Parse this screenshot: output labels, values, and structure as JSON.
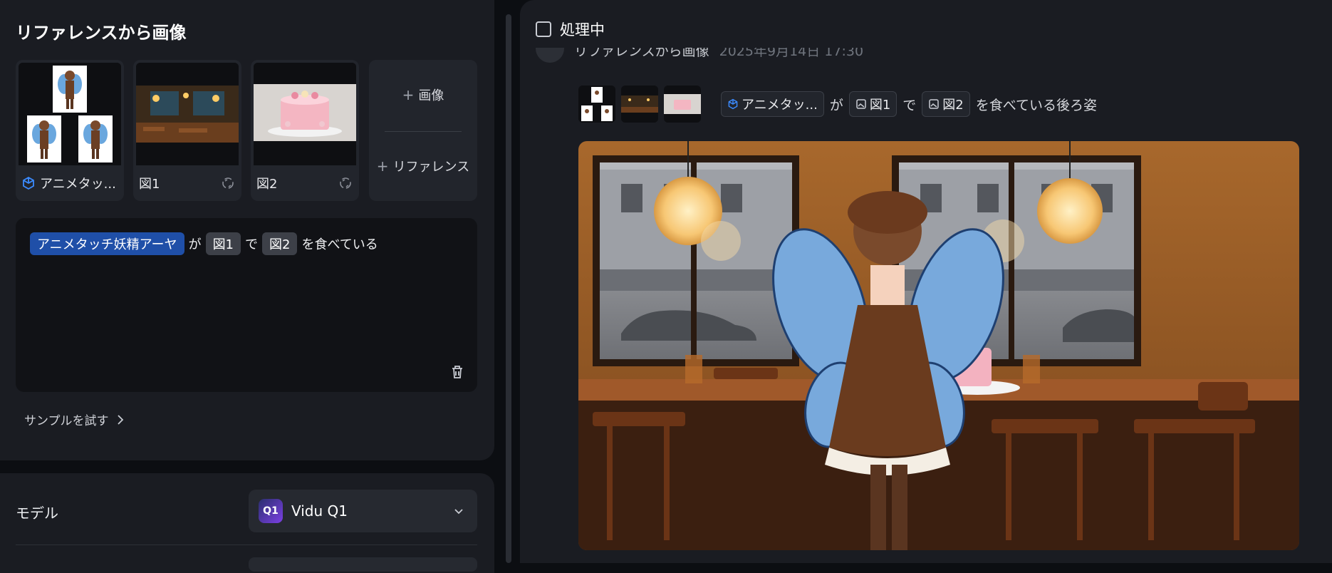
{
  "left_panel": {
    "title": "リファレンスから画像",
    "references": [
      {
        "label": "アニメタッ...",
        "icon": "cube-icon"
      },
      {
        "label": "図1",
        "icon": "swap-icon"
      },
      {
        "label": "図2",
        "icon": "swap-icon"
      }
    ],
    "add_image_label": "画像",
    "add_reference_label": "リファレンス",
    "prompt": {
      "character": "アニメタッチ妖精アーヤ",
      "particle_ga": "が",
      "fig1": "図1",
      "particle_de": "で",
      "fig2": "図2",
      "suffix": "を食べている"
    },
    "sample_label": "サンプルを試す",
    "model_label": "モデル",
    "model_logo_text": "Q1",
    "model_value": "Vidu Q1"
  },
  "right_panel": {
    "processing_label": "処理中",
    "history": {
      "title": "リファレンスから画像",
      "date": "2025年9月14日 17:30",
      "char_tag": "アニメタッ...",
      "particle_ga": "が",
      "fig1": "図1",
      "particle_de": "で",
      "fig2": "図2",
      "suffix": "を食べている後ろ姿"
    }
  },
  "colors": {
    "panel_bg": "#1a1c22",
    "page_bg": "#0c0e12",
    "chip_blue": "#1f4fa8",
    "chip_gray": "#3d4048"
  }
}
